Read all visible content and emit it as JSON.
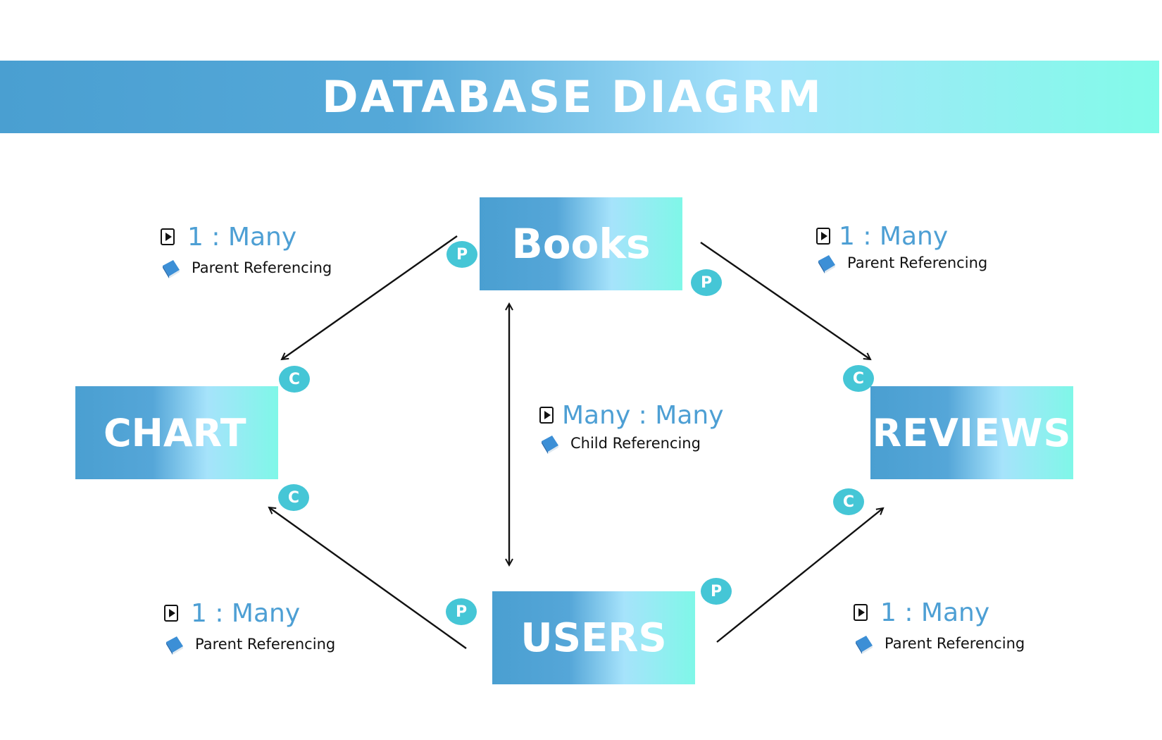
{
  "title": "DATABASE DIAGRM",
  "entities": {
    "books": "Books",
    "chart": "CHART",
    "reviews": "REVIEWS",
    "users": "USERS"
  },
  "badges": {
    "parent": "P",
    "child": "C"
  },
  "relations": {
    "books_chart": {
      "cardinality": "1 : Many",
      "reference": "Parent Referencing"
    },
    "books_reviews": {
      "cardinality": "1 : Many",
      "reference": "Parent Referencing"
    },
    "books_users": {
      "cardinality": "Many : Many",
      "reference": "Child Referencing"
    },
    "users_chart": {
      "cardinality": "1 : Many",
      "reference": "Parent Referencing"
    },
    "users_reviews": {
      "cardinality": "1 : Many",
      "reference": "Parent Referencing"
    }
  },
  "colors": {
    "gradient_start": "#4a9fd1",
    "gradient_end": "#82fbe9",
    "badge": "#45c6d6",
    "cardinality_text": "#4d9fd4"
  },
  "icons": {
    "cardinality": "play-icon",
    "reference": "book-icon"
  }
}
